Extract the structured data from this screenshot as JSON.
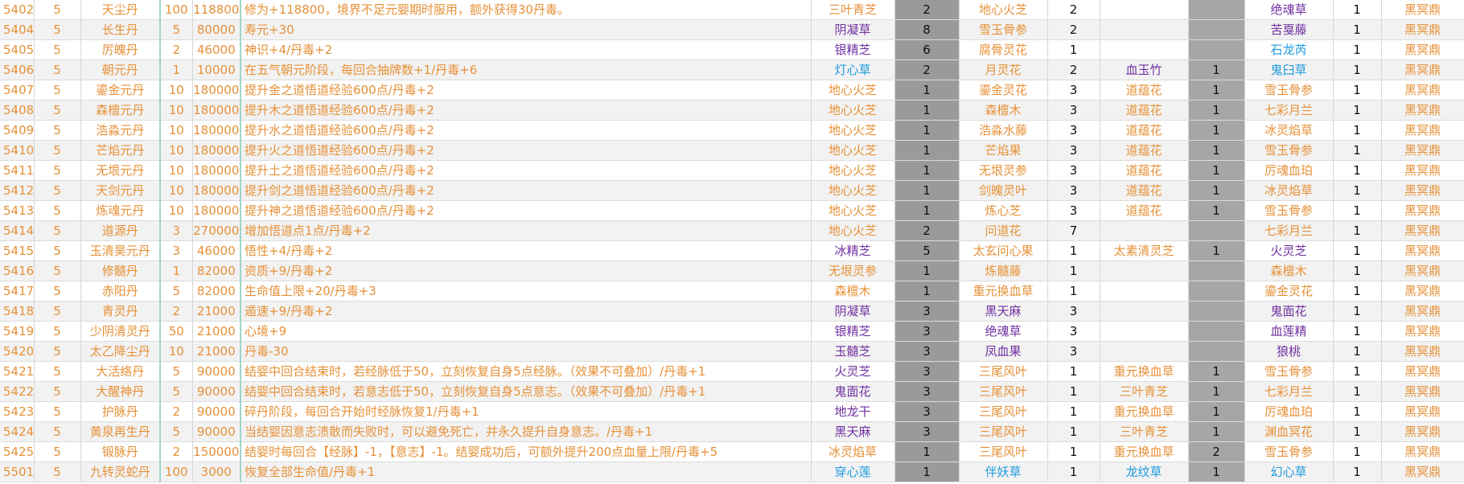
{
  "colors": {
    "orange": "#e69138",
    "purple": "#7030a0",
    "blue": "#1f9bde",
    "gray": "#9a9a9a"
  },
  "rows": [
    {
      "id": "5402",
      "grade": "5",
      "name": "天尘丹",
      "cost": "100",
      "price": "118800",
      "effect": "修为+118800，境界不足元婴期时服用，额外获得30丹毒。",
      "h1": "三叶青芝",
      "h1c": "orange",
      "q1": "2",
      "h2": "地心火芝",
      "h2c": "orange",
      "q2": "2",
      "h3": "",
      "h3c": "orange",
      "q3": "",
      "h4": "绝魂草",
      "h4c": "purple",
      "q4": "1",
      "furnace": "黑冥鼎"
    },
    {
      "id": "5404",
      "grade": "5",
      "name": "长生丹",
      "cost": "5",
      "price": "80000",
      "effect": "寿元+30",
      "h1": "阴凝草",
      "h1c": "purple",
      "q1": "8",
      "h2": "雪玉骨参",
      "h2c": "orange",
      "q2": "2",
      "h3": "",
      "h3c": "orange",
      "q3": "",
      "h4": "苦戛藤",
      "h4c": "purple",
      "q4": "1",
      "furnace": "黑冥鼎"
    },
    {
      "id": "5405",
      "grade": "5",
      "name": "厉魄丹",
      "cost": "2",
      "price": "46000",
      "effect": "神识+4/丹毒+2",
      "h1": "银精芝",
      "h1c": "purple",
      "q1": "6",
      "h2": "腐骨灵花",
      "h2c": "orange",
      "q2": "1",
      "h3": "",
      "h3c": "orange",
      "q3": "",
      "h4": "石龙芮",
      "h4c": "blue",
      "q4": "1",
      "furnace": "黑冥鼎"
    },
    {
      "id": "5406",
      "grade": "5",
      "name": "朝元丹",
      "cost": "1",
      "price": "10000",
      "effect": "在五气朝元阶段，每回合抽牌数+1/丹毒+6",
      "h1": "灯心草",
      "h1c": "blue",
      "q1": "2",
      "h2": "月灵花",
      "h2c": "orange",
      "q2": "2",
      "h3": "血玉竹",
      "h3c": "purple",
      "q3": "1",
      "h4": "鬼臼草",
      "h4c": "blue",
      "q4": "1",
      "furnace": "黑冥鼎"
    },
    {
      "id": "5407",
      "grade": "5",
      "name": "鎏金元丹",
      "cost": "10",
      "price": "180000",
      "effect": "提升金之道悟道经验600点/丹毒+2",
      "h1": "地心火芝",
      "h1c": "orange",
      "q1": "1",
      "h2": "鎏金灵花",
      "h2c": "orange",
      "q2": "3",
      "h3": "道蕴花",
      "h3c": "orange",
      "q3": "1",
      "h4": "雪玉骨参",
      "h4c": "orange",
      "q4": "1",
      "furnace": "黑冥鼎"
    },
    {
      "id": "5408",
      "grade": "5",
      "name": "森檀元丹",
      "cost": "10",
      "price": "180000",
      "effect": "提升木之道悟道经验600点/丹毒+2",
      "h1": "地心火芝",
      "h1c": "orange",
      "q1": "1",
      "h2": "森檀木",
      "h2c": "orange",
      "q2": "3",
      "h3": "道蕴花",
      "h3c": "orange",
      "q3": "1",
      "h4": "七彩月兰",
      "h4c": "orange",
      "q4": "1",
      "furnace": "黑冥鼎"
    },
    {
      "id": "5409",
      "grade": "5",
      "name": "浩淼元丹",
      "cost": "10",
      "price": "180000",
      "effect": "提升水之道悟道经验600点/丹毒+2",
      "h1": "地心火芝",
      "h1c": "orange",
      "q1": "1",
      "h2": "浩淼水藤",
      "h2c": "orange",
      "q2": "3",
      "h3": "道蕴花",
      "h3c": "orange",
      "q3": "1",
      "h4": "冰灵焰草",
      "h4c": "orange",
      "q4": "1",
      "furnace": "黑冥鼎"
    },
    {
      "id": "5410",
      "grade": "5",
      "name": "芒焰元丹",
      "cost": "10",
      "price": "180000",
      "effect": "提升火之道悟道经验600点/丹毒+2",
      "h1": "地心火芝",
      "h1c": "orange",
      "q1": "1",
      "h2": "芒焰果",
      "h2c": "orange",
      "q2": "3",
      "h3": "道蕴花",
      "h3c": "orange",
      "q3": "1",
      "h4": "雪玉骨参",
      "h4c": "orange",
      "q4": "1",
      "furnace": "黑冥鼎"
    },
    {
      "id": "5411",
      "grade": "5",
      "name": "无垠元丹",
      "cost": "10",
      "price": "180000",
      "effect": "提升土之道悟道经验600点/丹毒+2",
      "h1": "地心火芝",
      "h1c": "orange",
      "q1": "1",
      "h2": "无垠灵参",
      "h2c": "orange",
      "q2": "3",
      "h3": "道蕴花",
      "h3c": "orange",
      "q3": "1",
      "h4": "厉魂血珀",
      "h4c": "orange",
      "q4": "1",
      "furnace": "黑冥鼎"
    },
    {
      "id": "5412",
      "grade": "5",
      "name": "天剑元丹",
      "cost": "10",
      "price": "180000",
      "effect": "提升剑之道悟道经验600点/丹毒+2",
      "h1": "地心火芝",
      "h1c": "orange",
      "q1": "1",
      "h2": "剑魄灵叶",
      "h2c": "orange",
      "q2": "3",
      "h3": "道蕴花",
      "h3c": "orange",
      "q3": "1",
      "h4": "冰灵焰草",
      "h4c": "orange",
      "q4": "1",
      "furnace": "黑冥鼎"
    },
    {
      "id": "5413",
      "grade": "5",
      "name": "炼魂元丹",
      "cost": "10",
      "price": "180000",
      "effect": "提升神之道悟道经验600点/丹毒+2",
      "h1": "地心火芝",
      "h1c": "orange",
      "q1": "1",
      "h2": "炼心芝",
      "h2c": "orange",
      "q2": "3",
      "h3": "道蕴花",
      "h3c": "orange",
      "q3": "1",
      "h4": "雪玉骨参",
      "h4c": "orange",
      "q4": "1",
      "furnace": "黑冥鼎"
    },
    {
      "id": "5414",
      "grade": "5",
      "name": "道源丹",
      "cost": "3",
      "price": "270000",
      "effect": "增加悟道点1点/丹毒+2",
      "h1": "地心火芝",
      "h1c": "orange",
      "q1": "2",
      "h2": "问道花",
      "h2c": "orange",
      "q2": "7",
      "h3": "",
      "h3c": "orange",
      "q3": "",
      "h4": "七彩月兰",
      "h4c": "orange",
      "q4": "1",
      "furnace": "黑冥鼎"
    },
    {
      "id": "5415",
      "grade": "5",
      "name": "玉清昊元丹",
      "cost": "3",
      "price": "46000",
      "effect": "悟性+4/丹毒+2",
      "h1": "冰精芝",
      "h1c": "purple",
      "q1": "5",
      "h2": "太玄问心果",
      "h2c": "orange",
      "q2": "1",
      "h3": "太素清灵芝",
      "h3c": "orange",
      "q3": "1",
      "h4": "火灵芝",
      "h4c": "purple",
      "q4": "1",
      "furnace": "黑冥鼎"
    },
    {
      "id": "5416",
      "grade": "5",
      "name": "修髓丹",
      "cost": "1",
      "price": "82000",
      "effect": "资质+9/丹毒+2",
      "h1": "无垠灵参",
      "h1c": "orange",
      "q1": "1",
      "h2": "炼髓藤",
      "h2c": "orange",
      "q2": "1",
      "h3": "",
      "h3c": "orange",
      "q3": "",
      "h4": "森檀木",
      "h4c": "orange",
      "q4": "1",
      "furnace": "黑冥鼎"
    },
    {
      "id": "5417",
      "grade": "5",
      "name": "赤阳丹",
      "cost": "5",
      "price": "82000",
      "effect": "生命值上限+20/丹毒+3",
      "h1": "森檀木",
      "h1c": "orange",
      "q1": "1",
      "h2": "重元换血草",
      "h2c": "orange",
      "q2": "1",
      "h3": "",
      "h3c": "orange",
      "q3": "",
      "h4": "鎏金灵花",
      "h4c": "orange",
      "q4": "1",
      "furnace": "黑冥鼎"
    },
    {
      "id": "5418",
      "grade": "5",
      "name": "青灵丹",
      "cost": "2",
      "price": "21000",
      "effect": "遁速+9/丹毒+2",
      "h1": "阴凝草",
      "h1c": "purple",
      "q1": "3",
      "h2": "黑天麻",
      "h2c": "purple",
      "q2": "3",
      "h3": "",
      "h3c": "orange",
      "q3": "",
      "h4": "鬼面花",
      "h4c": "purple",
      "q4": "1",
      "furnace": "黑冥鼎"
    },
    {
      "id": "5419",
      "grade": "5",
      "name": "少阴清灵丹",
      "cost": "50",
      "price": "21000",
      "effect": "心境+9",
      "h1": "银精芝",
      "h1c": "purple",
      "q1": "3",
      "h2": "绝魂草",
      "h2c": "purple",
      "q2": "3",
      "h3": "",
      "h3c": "orange",
      "q3": "",
      "h4": "血莲精",
      "h4c": "purple",
      "q4": "1",
      "furnace": "黑冥鼎"
    },
    {
      "id": "5420",
      "grade": "5",
      "name": "太乙降尘丹",
      "cost": "10",
      "price": "21000",
      "effect": "丹毒-30",
      "h1": "玉髓芝",
      "h1c": "purple",
      "q1": "3",
      "h2": "凤血果",
      "h2c": "purple",
      "q2": "3",
      "h3": "",
      "h3c": "orange",
      "q3": "",
      "h4": "狼桃",
      "h4c": "purple",
      "q4": "1",
      "furnace": "黑冥鼎"
    },
    {
      "id": "5421",
      "grade": "5",
      "name": "大活络丹",
      "cost": "5",
      "price": "90000",
      "effect": "结婴中回合结束时，若经脉低于50，立刻恢复自身5点经脉。（效果不可叠加）/丹毒+1",
      "h1": "火灵芝",
      "h1c": "purple",
      "q1": "3",
      "h2": "三尾风叶",
      "h2c": "orange",
      "q2": "1",
      "h3": "重元换血草",
      "h3c": "orange",
      "q3": "1",
      "h4": "雪玉骨参",
      "h4c": "orange",
      "q4": "1",
      "furnace": "黑冥鼎"
    },
    {
      "id": "5422",
      "grade": "5",
      "name": "大醒神丹",
      "cost": "5",
      "price": "90000",
      "effect": "结婴中回合结束时，若意志低于50，立刻恢复自身5点意志。（效果不可叠加）/丹毒+1",
      "h1": "鬼面花",
      "h1c": "purple",
      "q1": "3",
      "h2": "三尾风叶",
      "h2c": "orange",
      "q2": "1",
      "h3": "三叶青芝",
      "h3c": "orange",
      "q3": "1",
      "h4": "七彩月兰",
      "h4c": "orange",
      "q4": "1",
      "furnace": "黑冥鼎"
    },
    {
      "id": "5423",
      "grade": "5",
      "name": "护脉丹",
      "cost": "2",
      "price": "90000",
      "effect": "碎丹阶段，每回合开始时经脉恢复1/丹毒+1",
      "h1": "地龙干",
      "h1c": "purple",
      "q1": "3",
      "h2": "三尾风叶",
      "h2c": "orange",
      "q2": "1",
      "h3": "重元换血草",
      "h3c": "orange",
      "q3": "1",
      "h4": "厉魂血珀",
      "h4c": "orange",
      "q4": "1",
      "furnace": "黑冥鼎"
    },
    {
      "id": "5424",
      "grade": "5",
      "name": "黄泉再生丹",
      "cost": "5",
      "price": "90000",
      "effect": "当结婴因意志溃散而失败时，可以避免死亡，并永久提升自身意志。/丹毒+1",
      "h1": "黑天麻",
      "h1c": "purple",
      "q1": "3",
      "h2": "三尾风叶",
      "h2c": "orange",
      "q2": "1",
      "h3": "三叶青芝",
      "h3c": "orange",
      "q3": "1",
      "h4": "渊血冥花",
      "h4c": "orange",
      "q4": "1",
      "furnace": "黑冥鼎"
    },
    {
      "id": "5425",
      "grade": "5",
      "name": "锻脉丹",
      "cost": "2",
      "price": "150000",
      "effect": "结婴时每回合【经脉】-1，【意志】-1。结婴成功后，可额外提升200点血量上限/丹毒+5",
      "h1": "冰灵焰草",
      "h1c": "orange",
      "q1": "1",
      "h2": "三尾风叶",
      "h2c": "orange",
      "q2": "1",
      "h3": "重元换血草",
      "h3c": "orange",
      "q3": "2",
      "h4": "雪玉骨参",
      "h4c": "orange",
      "q4": "1",
      "furnace": "黑冥鼎"
    },
    {
      "id": "5501",
      "grade": "5",
      "name": "九转灵蛇丹",
      "cost": "100",
      "price": "3000",
      "effect": "恢复全部生命值/丹毒+1",
      "h1": "穿心莲",
      "h1c": "blue",
      "q1": "1",
      "h2": "伴妖草",
      "h2c": "blue",
      "q2": "1",
      "h3": "龙纹草",
      "h3c": "blue",
      "q3": "1",
      "h4": "幻心草",
      "h4c": "blue",
      "q4": "1",
      "furnace": "黑冥鼎"
    }
  ]
}
